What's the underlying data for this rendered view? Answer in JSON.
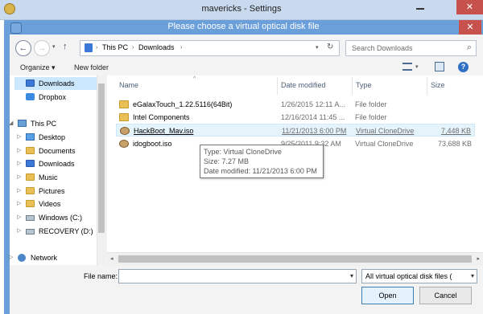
{
  "background_window": {
    "title": "mavericks - Settings",
    "close": "✕"
  },
  "dialog": {
    "title": "Please choose a virtual optical disk file",
    "close": "✕"
  },
  "address": {
    "crumbs": [
      "This PC",
      "Downloads"
    ]
  },
  "search": {
    "placeholder": "Search Downloads"
  },
  "toolbar": {
    "organize": "Organize ▾",
    "new_folder": "New folder"
  },
  "nav": {
    "items": [
      {
        "label": "Downloads",
        "icon": "downloads-folder-icon",
        "selected": true
      },
      {
        "label": "Dropbox",
        "icon": "dropbox-icon"
      },
      {
        "label": "This PC",
        "icon": "computer-icon"
      },
      {
        "label": "Desktop",
        "icon": "desktop-icon"
      },
      {
        "label": "Documents",
        "icon": "documents-icon"
      },
      {
        "label": "Downloads",
        "icon": "downloads-folder-icon"
      },
      {
        "label": "Music",
        "icon": "music-icon"
      },
      {
        "label": "Pictures",
        "icon": "pictures-icon"
      },
      {
        "label": "Videos",
        "icon": "videos-icon"
      },
      {
        "label": "Windows (C:)",
        "icon": "drive-icon"
      },
      {
        "label": "RECOVERY (D:)",
        "icon": "drive-icon"
      },
      {
        "label": "Network",
        "icon": "network-icon"
      }
    ]
  },
  "columns": {
    "name": "Name",
    "date": "Date modified",
    "type": "Type",
    "size": "Size"
  },
  "files": [
    {
      "name": "eGalaxTouch_1.22.5116(64Bit)",
      "date": "1/26/2015 12:11 A...",
      "type": "File folder",
      "size": ""
    },
    {
      "name": "Intel Components",
      "date": "12/16/2014 11:45 ...",
      "type": "File folder",
      "size": ""
    },
    {
      "name": "HackBoot_Mav.iso",
      "date": "11/21/2013 6:00 PM",
      "type": "Virtual CloneDrive",
      "size": "7,448 KB"
    },
    {
      "name": "idogboot.iso",
      "date": "9/25/2011 9:32 AM",
      "type": "Virtual CloneDrive",
      "size": "73,688 KB"
    }
  ],
  "tooltip": {
    "type": "Type: Virtual CloneDrive",
    "size": "Size: 7.27 MB",
    "date": "Date modified: 11/21/2013 6:00 PM"
  },
  "bottom": {
    "file_name_label": "File name:",
    "file_name_value": "",
    "filter": "All virtual optical disk files (",
    "open": "Open",
    "cancel": "Cancel"
  },
  "colors": {
    "dialog_frame": "#6b9fd9",
    "close_button": "#c7514c",
    "selection": "#cce8ff"
  }
}
